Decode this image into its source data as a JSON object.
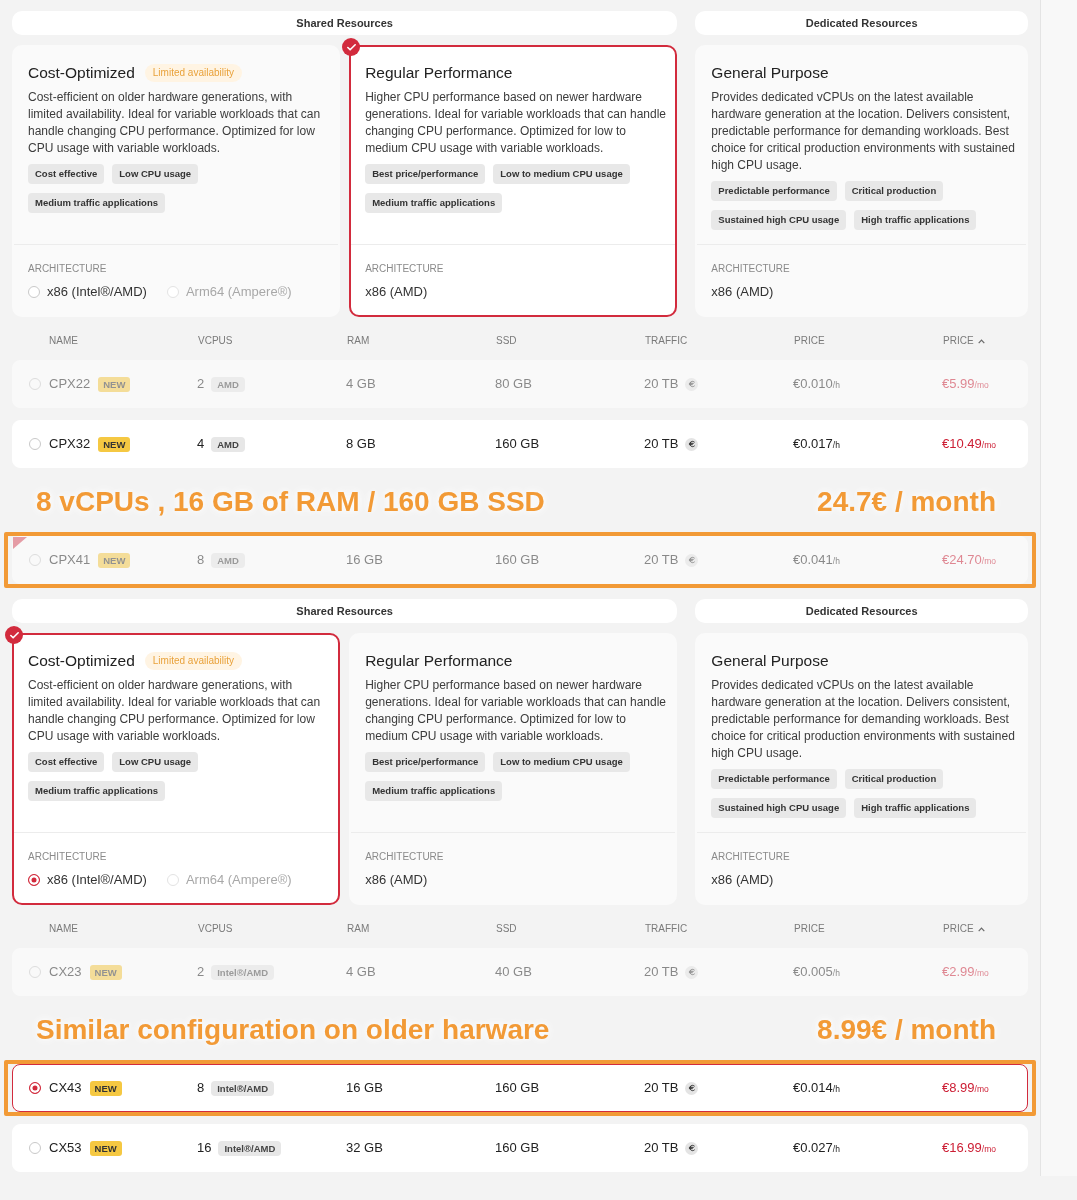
{
  "panels": [
    {
      "groups": [
        {
          "label": "Shared Resources",
          "cards": [
            {
              "title": "Cost-Optimized",
              "badge": "Limited availability",
              "description": "Cost-efficient on older hardware generations, with limited availability. Ideal for variable workloads that can handle changing CPU performance. Optimized for low CPU usage with variable workloads.",
              "tags": [
                "Cost effective",
                "Low CPU usage",
                "Medium traffic applications"
              ],
              "architecture": {
                "label": "ARCHITECTURE",
                "options": [
                  {
                    "label": "x86 (Intel®/AMD)",
                    "selected": false,
                    "disabled": false
                  },
                  {
                    "label": "Arm64 (Ampere®)",
                    "selected": false,
                    "disabled": true
                  }
                ]
              },
              "selected": false
            },
            {
              "title": "Regular Performance",
              "description": "Higher CPU performance based on newer hardware generations. Ideal for variable workloads that can handle changing CPU performance. Optimized for low to medium CPU usage with variable workloads.",
              "tags": [
                "Best price/performance",
                "Low to medium CPU usage",
                "Medium traffic applications"
              ],
              "architecture": {
                "label": "ARCHITECTURE",
                "value": "x86 (AMD)"
              },
              "selected": true
            }
          ]
        },
        {
          "label": "Dedicated Resources",
          "cards": [
            {
              "title": "General Purpose",
              "description": "Provides dedicated vCPUs on the latest available hardware generation at the location. Delivers consistent, predictable performance for demanding workloads. Best choice for critical production environments with sustained high CPU usage.",
              "tags": [
                "Predictable performance",
                "Critical production",
                "Sustained high CPU usage",
                "High traffic applications"
              ],
              "architecture": {
                "label": "ARCHITECTURE",
                "value": "x86 (AMD)"
              },
              "selected": false
            }
          ]
        }
      ],
      "table": {
        "columns": [
          {
            "label": "NAME",
            "sorted": false
          },
          {
            "label": "VCPUS",
            "sorted": false
          },
          {
            "label": "RAM",
            "sorted": false
          },
          {
            "label": "SSD",
            "sorted": false
          },
          {
            "label": "TRAFFIC",
            "sorted": false
          },
          {
            "label": "PRICE",
            "sorted": false
          },
          {
            "label": "PRICE",
            "sorted": true
          }
        ],
        "rows": [
          {
            "kind": "server",
            "name": "CPX22",
            "badge": "NEW",
            "vcpus": "2",
            "cpu": "AMD",
            "ram": "4 GB",
            "ssd": "80 GB",
            "traffic": "20 TB",
            "hourly_price": "€0.010$_{/h}$",
            "monthly_price": "€5.99$_{/mo}$",
            "disabled": true,
            "selected": false,
            "highlighted": false,
            "flagged": false
          },
          {
            "kind": "server",
            "name": "CPX32",
            "badge": "NEW",
            "vcpus": "4",
            "cpu": "AMD",
            "ram": "8 GB",
            "ssd": "160 GB",
            "traffic": "20 TB",
            "hourly_price": "€0.017$_{/h}$",
            "monthly_price": "€10.49$_{/mo}$",
            "disabled": false,
            "selected": false,
            "highlighted": false,
            "flagged": false
          },
          {
            "kind": "note",
            "headline": "8 vCPUs , 16 GB of RAM / 160 GB SSD",
            "price": "24.7€ / month"
          },
          {
            "kind": "server",
            "name": "CPX41",
            "badge": "NEW",
            "vcpus": "8",
            "cpu": "AMD",
            "ram": "16 GB",
            "ssd": "160 GB",
            "traffic": "20 TB",
            "hourly_price": "€0.041$_{/h}$",
            "monthly_price": "€24.70$_{/mo}$",
            "disabled": true,
            "selected": false,
            "highlighted": true,
            "flagged": true
          }
        ]
      }
    },
    {
      "groups": [
        {
          "label": "Shared Resources",
          "cards": [
            {
              "title": "Cost-Optimized",
              "badge": "Limited availability",
              "description": "Cost-efficient on older hardware generations, with limited availability. Ideal for variable workloads that can handle changing CPU performance. Optimized for low CPU usage with variable workloads.",
              "tags": [
                "Cost effective",
                "Low CPU usage",
                "Medium traffic applications"
              ],
              "architecture": {
                "label": "ARCHITECTURE",
                "options": [
                  {
                    "label": "x86 (Intel®/AMD)",
                    "selected": true,
                    "disabled": false
                  },
                  {
                    "label": "Arm64 (Ampere®)",
                    "selected": false,
                    "disabled": true
                  }
                ]
              },
              "selected": true
            },
            {
              "title": "Regular Performance",
              "description": "Higher CPU performance based on newer hardware generations. Ideal for variable workloads that can handle changing CPU performance. Optimized for low to medium CPU usage with variable workloads.",
              "tags": [
                "Best price/performance",
                "Low to medium CPU usage",
                "Medium traffic applications"
              ],
              "architecture": {
                "label": "ARCHITECTURE",
                "value": "x86 (AMD)"
              },
              "selected": false
            }
          ]
        },
        {
          "label": "Dedicated Resources",
          "cards": [
            {
              "title": "General Purpose",
              "description": "Provides dedicated vCPUs on the latest available hardware generation at the location. Delivers consistent, predictable performance for demanding workloads. Best choice for critical production environments with sustained high CPU usage.",
              "tags": [
                "Predictable performance",
                "Critical production",
                "Sustained high CPU usage",
                "High traffic applications"
              ],
              "architecture": {
                "label": "ARCHITECTURE",
                "value": "x86 (AMD)"
              },
              "selected": false
            }
          ]
        }
      ],
      "table": {
        "columns": [
          {
            "label": "NAME",
            "sorted": false
          },
          {
            "label": "VCPUS",
            "sorted": false
          },
          {
            "label": "RAM",
            "sorted": false
          },
          {
            "label": "SSD",
            "sorted": false
          },
          {
            "label": "TRAFFIC",
            "sorted": false
          },
          {
            "label": "PRICE",
            "sorted": false
          },
          {
            "label": "PRICE",
            "sorted": true
          }
        ],
        "rows": [
          {
            "kind": "server",
            "name": "CX23",
            "badge": "NEW",
            "vcpus": "2",
            "cpu": "Intel®/AMD",
            "ram": "4 GB",
            "ssd": "40 GB",
            "traffic": "20 TB",
            "hourly_price": "€0.005$_{/h}$",
            "monthly_price": "€2.99$_{/mo}$",
            "disabled": true,
            "selected": false,
            "highlighted": false,
            "flagged": false
          },
          {
            "kind": "note",
            "headline": "Similar configuration on older harware",
            "price": "8.99€ / month"
          },
          {
            "kind": "server",
            "name": "CX43",
            "badge": "NEW",
            "vcpus": "8",
            "cpu": "Intel®/AMD",
            "ram": "16 GB",
            "ssd": "160 GB",
            "traffic": "20 TB",
            "hourly_price": "€0.014$_{/h}$",
            "monthly_price": "€8.99$_{/mo}$",
            "disabled": false,
            "selected": true,
            "highlighted": true,
            "flagged": false
          },
          {
            "kind": "server",
            "name": "CX53",
            "badge": "NEW",
            "vcpus": "16",
            "cpu": "Intel®/AMD",
            "ram": "32 GB",
            "ssd": "160 GB",
            "traffic": "20 TB",
            "hourly_price": "€0.027$_{/h}$",
            "monthly_price": "€16.99$_{/mo}$",
            "disabled": false,
            "selected": false,
            "highlighted": false,
            "flagged": false
          }
        ]
      }
    }
  ]
}
